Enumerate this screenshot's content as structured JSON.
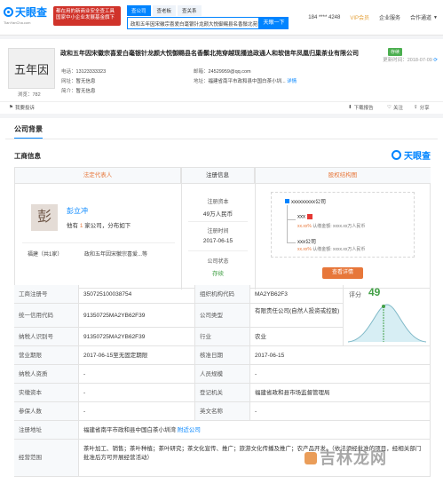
{
  "header": {
    "logo_text": "天眼查",
    "logo_sub": "TianYanCha.com",
    "promo_line1": "都在用的新商业安全查工具",
    "promo_line2": "国家中小企业发展基金旗下",
    "search_tabs": [
      "查公司",
      "查老板",
      "查关系"
    ],
    "search_value": "政和五年因宋徽宗喜爱白毫银针龙颜大悦御赐县名香鬃北苑穿越",
    "search_button": "天眼一下",
    "phone_masked": "184 **** 4248",
    "vip_label": "VIP会员",
    "nav_enterprise": "企业服务",
    "nav_cooperation": "合作通道"
  },
  "company": {
    "avatar_text": "五年因",
    "views": "浏览：782",
    "name": "政和五年因宋徽宗喜爱白毫银针龙颜大悦御赐县名香鬃北苑穿越现播追政通人和软信年凤凰归巢茶业有限公司",
    "status_tag": "存续",
    "update_label": "更新时间：2018-07-09",
    "phone_label": "电话：",
    "phone_value": "13123333323",
    "email_label": "邮箱：",
    "email_value": "24529959@qq.com",
    "website_label": "网址：",
    "website_value": "暂无信息",
    "address_label": "地址：",
    "address_value": "福建省南平市政和县中国白茶小圳...",
    "address_link": "详情",
    "intro_label": "简介：",
    "intro_value": "暂无信息",
    "report_btn": "我要投诉",
    "download_btn": "下载报告",
    "follow_btn": "关注",
    "share_btn": "分享"
  },
  "main": {
    "section_tab": "公司背景",
    "sub_title": "工商信息",
    "brand_text": "天眼查",
    "col_legal": "法定代表人",
    "col_reg": "注册信息",
    "col_equity": "股权结构图",
    "legal": {
      "avatar_char": "彭",
      "name": "彭立冲",
      "desc_prefix": "他有",
      "desc_count": "1",
      "desc_suffix": "家公司，分布如下",
      "location": "福建（共1家）",
      "company_short": "政和五年因宋徽宗喜爱...等"
    },
    "reg": {
      "capital_label": "注册资本",
      "capital_value": "49万人民币",
      "date_label": "注册时间",
      "date_value": "2017-06-15",
      "status_label": "公司状态",
      "status_value": "存续"
    },
    "equity": {
      "company": "xxxxxxxxx公司",
      "node1": "xxx",
      "node1_sub_pct": "xx.xx%",
      "node1_sub_text": " 认缴金额: xxxx.xx万人民币",
      "node2": "xxx公司",
      "node2_sub_pct": "xx.xx%",
      "node2_sub_text": " 认缴金额: xxxx.xx万人民币",
      "detail_btn": "查看详情"
    },
    "score": {
      "label": "评分",
      "value": "49"
    },
    "rows": [
      {
        "l1": "工商注册号",
        "v1": "350725100038754",
        "l2": "组织机构代码",
        "v2": "MA2YB62F3"
      },
      {
        "l1": "统一信用代码",
        "v1": "91350725MA2YB62F39",
        "l2": "公司类型",
        "v2": "有限责任公司(自然人投资或控股)"
      },
      {
        "l1": "纳税人识别号",
        "v1": "91350725MA2YB62F39",
        "l2": "行业",
        "v2": "农业"
      },
      {
        "l1": "营业期限",
        "v1": "2017-06-15至无固定期限",
        "l2": "核准日期",
        "v2": "2017-06-15"
      },
      {
        "l1": "纳税人资质",
        "v1": "-",
        "l2": "人员规模",
        "v2": "-"
      },
      {
        "l1": "实缴资本",
        "v1": "-",
        "l2": "登记机关",
        "v2": "福建省政和县市场监督管理局"
      },
      {
        "l1": "参保人数",
        "v1": "-",
        "l2": "英文名称",
        "v2": "-"
      }
    ],
    "address_label": "注册地址",
    "address_value": "福建省南平市政和县中国白茶小圳湾",
    "address_link": "附近公司",
    "scope_label": "经营范围",
    "scope_value": "茶叶加工、销售；茶叶种植；茶叶研究；茶文化宣传、推广；旅游文化传播及推广；农产品开发。（依法须经批准的项目，经相关部门批准后方可开展经营活动）",
    "watermark": "吉林龙网"
  }
}
